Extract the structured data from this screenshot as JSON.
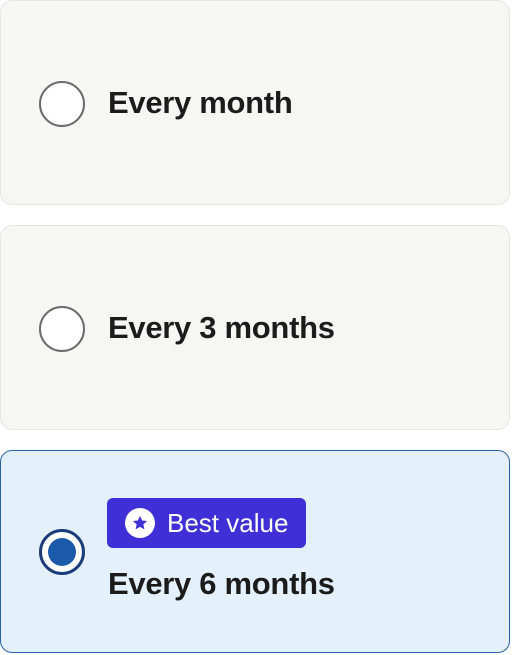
{
  "options": [
    {
      "label": "Every month",
      "selected": false
    },
    {
      "label": "Every 3 months",
      "selected": false
    },
    {
      "label": "Every 6 months",
      "selected": true,
      "badge": {
        "text": "Best value",
        "icon": "star-icon"
      }
    }
  ],
  "colors": {
    "card_bg": "#f6f6f2",
    "selected_bg": "#e4f0fb",
    "selected_border": "#2a64a8",
    "radio_fill": "#1a5aa8",
    "badge_bg": "#3f2fd6"
  }
}
